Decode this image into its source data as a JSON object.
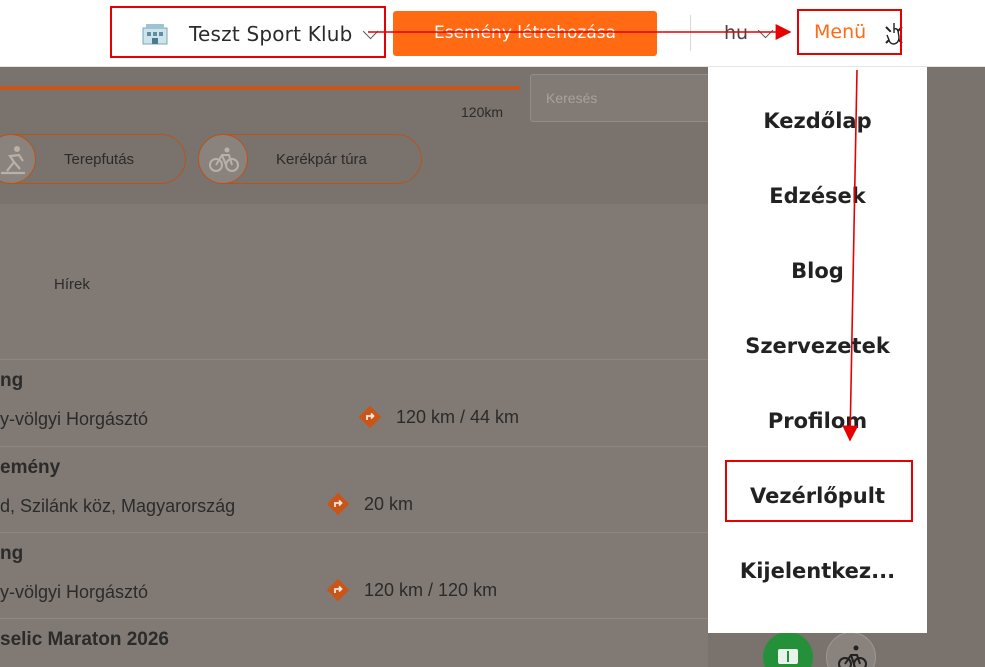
{
  "header": {
    "club_name": "Teszt Sport Klub",
    "create_event_label": "Esemény létrehozása",
    "language": "hu",
    "menu_label": "Menü"
  },
  "filters": {
    "distance_label": "120km",
    "search_placeholder": "Keresés",
    "chips": [
      "Terepfutás",
      "Kerékpár túra"
    ]
  },
  "news_label": "Hírek",
  "events": [
    {
      "title": "ng",
      "location": "y-völgyi Horgásztó",
      "distance": "120 km / 44 km"
    },
    {
      "title": "emény",
      "location": "d, Szilánk köz, Magyarország",
      "distance": "20 km"
    },
    {
      "title": "ng",
      "location": "y-völgyi Horgásztó",
      "distance": "120 km / 120 km"
    },
    {
      "title": "selic Maraton 2026",
      "location": "",
      "distance": ""
    }
  ],
  "menu": {
    "items": [
      "Kezdőlap",
      "Edzések",
      "Blog",
      "Szervezetek",
      "Profilom",
      "Vezérlőpult",
      "Kijelentkez..."
    ]
  },
  "colors": {
    "accent": "#ff6a13",
    "annotation": "#e60000",
    "overlay": "#7a726c"
  }
}
